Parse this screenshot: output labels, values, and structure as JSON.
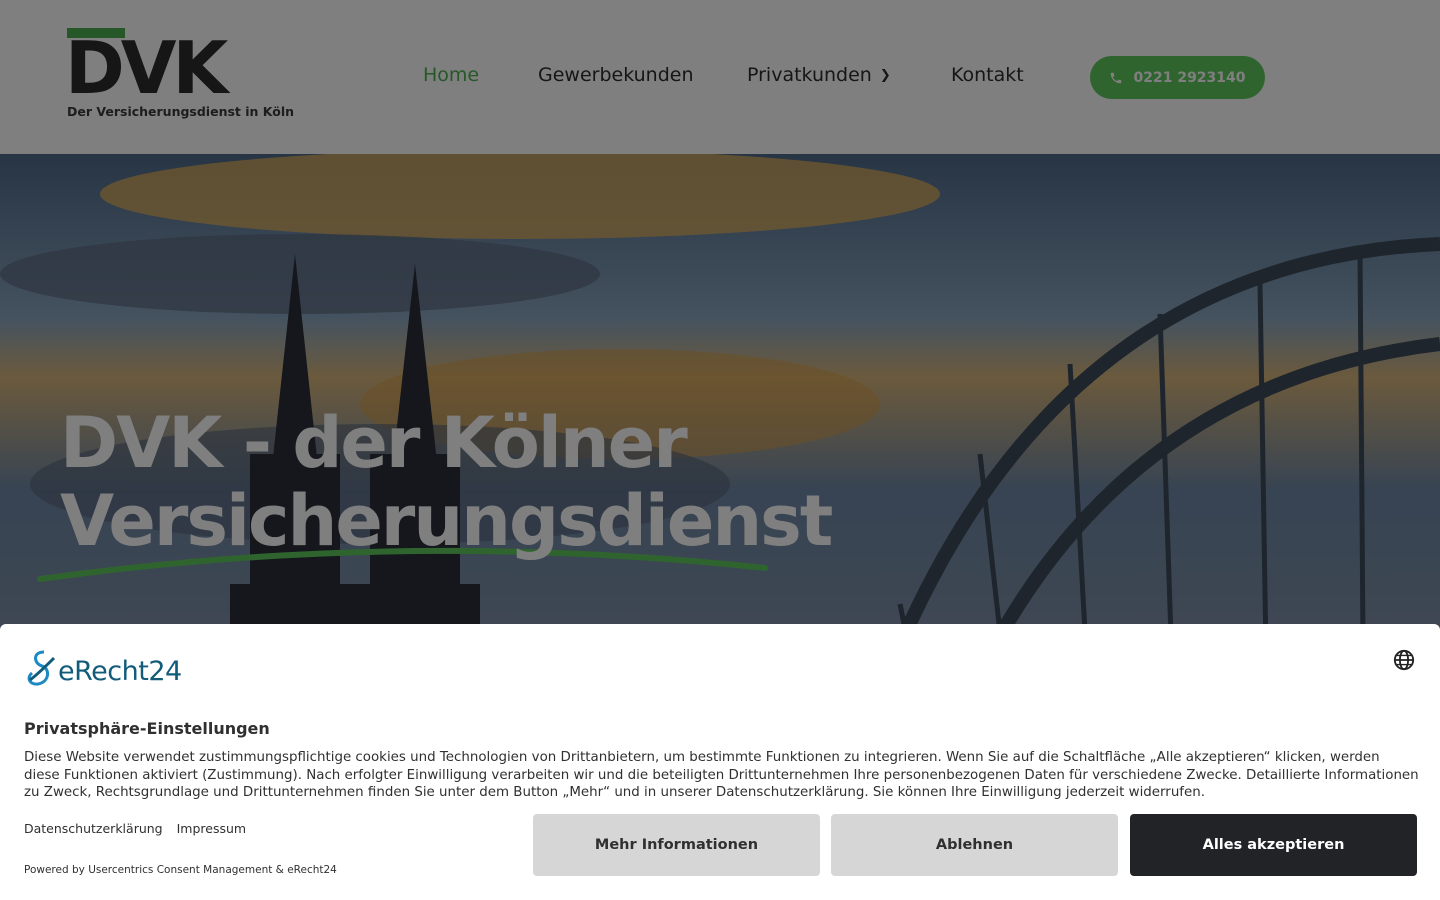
{
  "header": {
    "logo_text": "DVK",
    "logo_subtitle": "Der Versicherungsdienst in Köln",
    "nav": [
      {
        "label": "Home",
        "active": true
      },
      {
        "label": "Gewerbekunden",
        "active": false
      },
      {
        "label": "Privatkunden",
        "active": false,
        "has_dropdown": true
      },
      {
        "label": "Kontakt",
        "active": false
      }
    ],
    "phone_label": "0221 2923140",
    "accent_color": "#4caf50"
  },
  "hero": {
    "title_line1": "DVK - der Kölner",
    "title_line2": "Versicherungsdienst"
  },
  "consent": {
    "brand": "eRecht24",
    "title": "Privatsphäre-Einstellungen",
    "text": "Diese Website verwendet zustimmungspflichtige cookies und Technologien von Drittanbietern, um bestimmte Funktionen zu integrieren. Wenn Sie auf die Schaltfläche „Alle akzeptieren“ klicken, werden diese Funktionen aktiviert (Zustimmung). Nach erfolgter Einwilligung verarbeiten wir und die beteiligten Drittunternehmen Ihre personenbezogenen Daten für verschiedene Zwecke. Detaillierte Informationen zu Zweck, Rechtsgrundlage und Drittunternehmen finden Sie unter dem Button „Mehr“ und in unserer Datenschutzerklärung. Sie können Ihre Einwilligung jederzeit widerrufen.",
    "link_privacy": "Datenschutzerklärung",
    "link_imprint": "Impressum",
    "powered_by": "Powered by Usercentrics Consent Management & eRecht24",
    "btn_more": "Mehr Informationen",
    "btn_deny": "Ablehnen",
    "btn_accept": "Alles akzeptieren"
  }
}
